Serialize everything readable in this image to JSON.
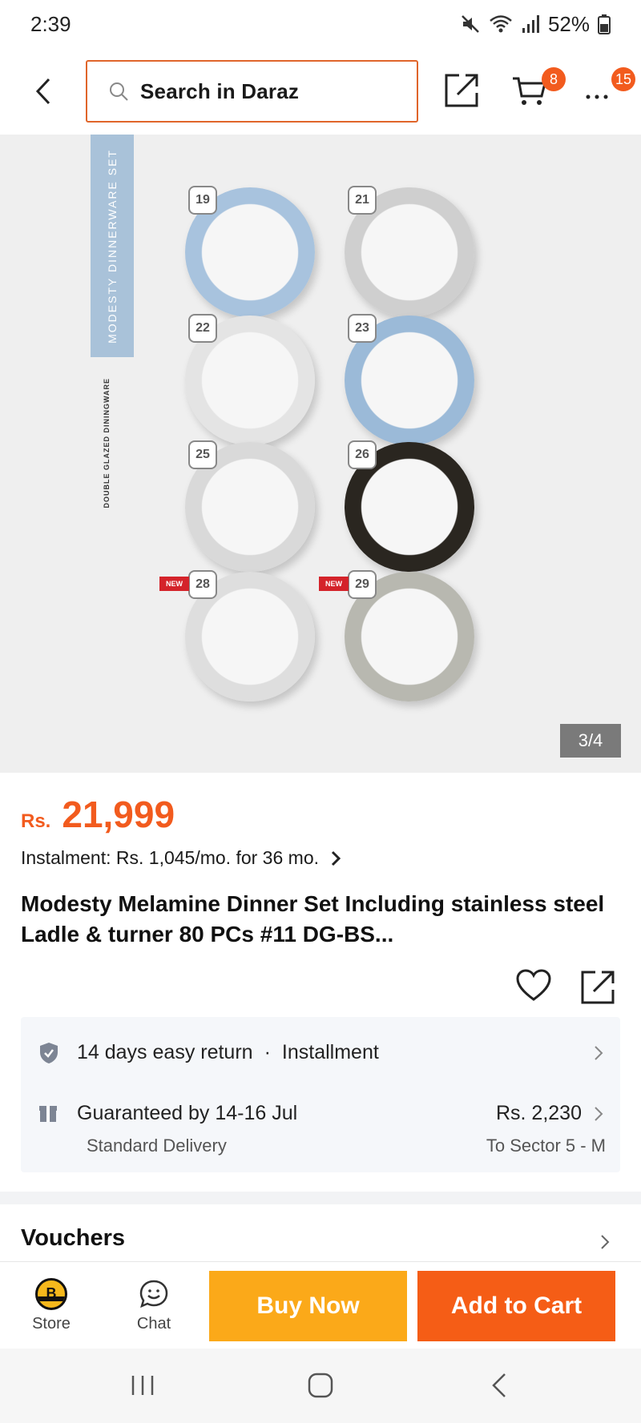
{
  "status_bar": {
    "time": "2:39",
    "battery": "52%"
  },
  "top_nav": {
    "search_placeholder": "Search in Daraz",
    "cart_count": "8",
    "more_count": "15"
  },
  "product_image": {
    "side_title": "MODESTY DINNERWARE SET",
    "side_subtitle": "DOUBLE GLAZED DININGWARE",
    "plates": [
      {
        "number": "19",
        "color": "#a8c3de",
        "new": false
      },
      {
        "number": "21",
        "color": "#cfcfcf",
        "new": false
      },
      {
        "number": "22",
        "color": "#e4e4e4",
        "new": false
      },
      {
        "number": "23",
        "color": "#9bbad8",
        "new": false
      },
      {
        "number": "25",
        "color": "#d9d9d9",
        "new": false
      },
      {
        "number": "26",
        "color": "#2a2620",
        "new": false
      },
      {
        "number": "28",
        "color": "#dedede",
        "new": true
      },
      {
        "number": "29",
        "color": "#b8b8b0",
        "new": true
      }
    ],
    "new_label": "NEW",
    "counter": "3/4"
  },
  "product": {
    "currency": "Rs.",
    "price": "21,999",
    "instalment": "Instalment: Rs. 1,045/mo. for 36 mo.",
    "title": "Modesty Melamine Dinner Set Including stainless steel Ladle & turner 80 PCs #11 DG-BS..."
  },
  "delivery": {
    "return_text": "14 days easy return",
    "dot": "·",
    "installment_text": "Installment",
    "guarantee_text": "Guaranteed by 14-16 Jul",
    "delivery_type": "Standard Delivery",
    "ship_price": "Rs. 2,230",
    "ship_dest": "To Sector 5 - M"
  },
  "vouchers": {
    "label": "Vouchers"
  },
  "action_bar": {
    "store_label": "Store",
    "chat_label": "Chat",
    "buy_now_label": "Buy Now",
    "add_to_cart_label": "Add to Cart"
  },
  "colors": {
    "accent": "#f25b1e",
    "buy_now": "#fba919",
    "add_to_cart": "#f55d16"
  }
}
